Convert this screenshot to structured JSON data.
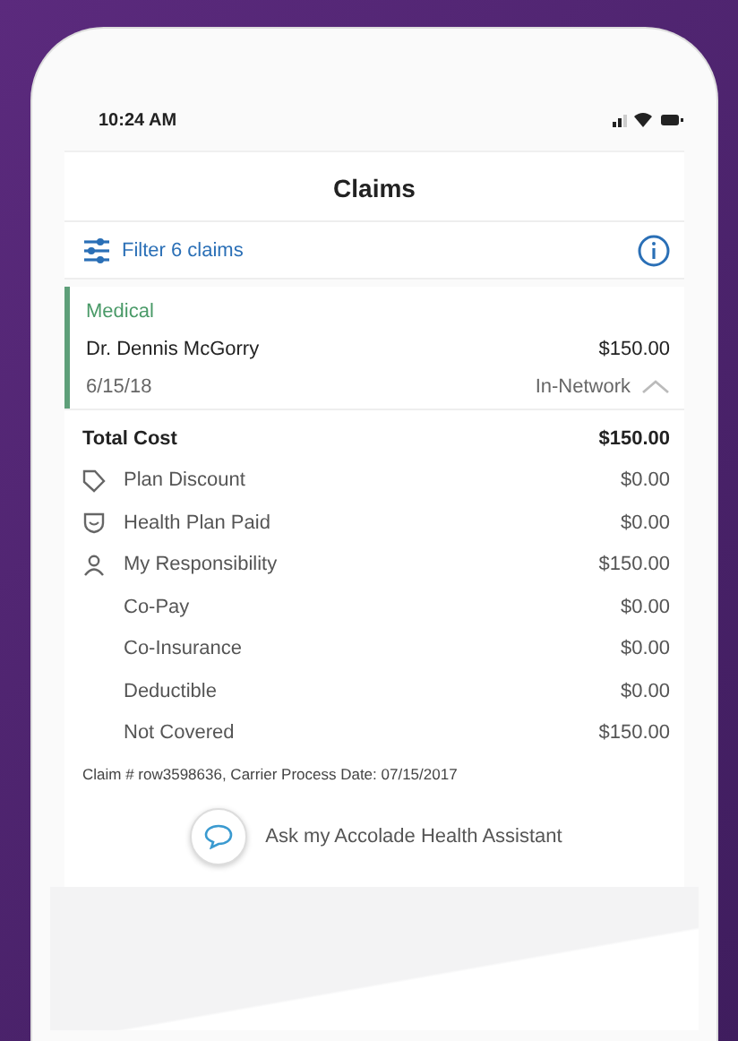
{
  "status_bar": {
    "time": "10:24 AM"
  },
  "header": {
    "title": "Claims"
  },
  "filter": {
    "label": "Filter 6 claims"
  },
  "claim": {
    "category": "Medical",
    "provider": "Dr. Dennis McGorry",
    "amount": "$150.00",
    "date": "6/15/18",
    "network": "In-Network",
    "expanded": true
  },
  "breakdown": [
    {
      "kind": "total",
      "label": "Total Cost",
      "value": "$150.00"
    },
    {
      "kind": "discount",
      "label": "Plan Discount",
      "value": "$0.00"
    },
    {
      "kind": "paid",
      "label": "Health Plan Paid",
      "value": "$0.00"
    },
    {
      "kind": "responsibility",
      "label": "My Responsibility",
      "value": "$150.00"
    },
    {
      "kind": "sub",
      "label": "Co-Pay",
      "value": "$0.00"
    },
    {
      "kind": "sub",
      "label": "Co-Insurance",
      "value": "$0.00"
    },
    {
      "kind": "sub",
      "label": "Deductible",
      "value": "$0.00"
    },
    {
      "kind": "sub",
      "label": "Not Covered",
      "value": "$150.00"
    }
  ],
  "claim_note": "Claim # row3598636, Carrier Process Date: 07/15/2017",
  "assistant": {
    "label": "Ask my Accolade Health Assistant"
  }
}
